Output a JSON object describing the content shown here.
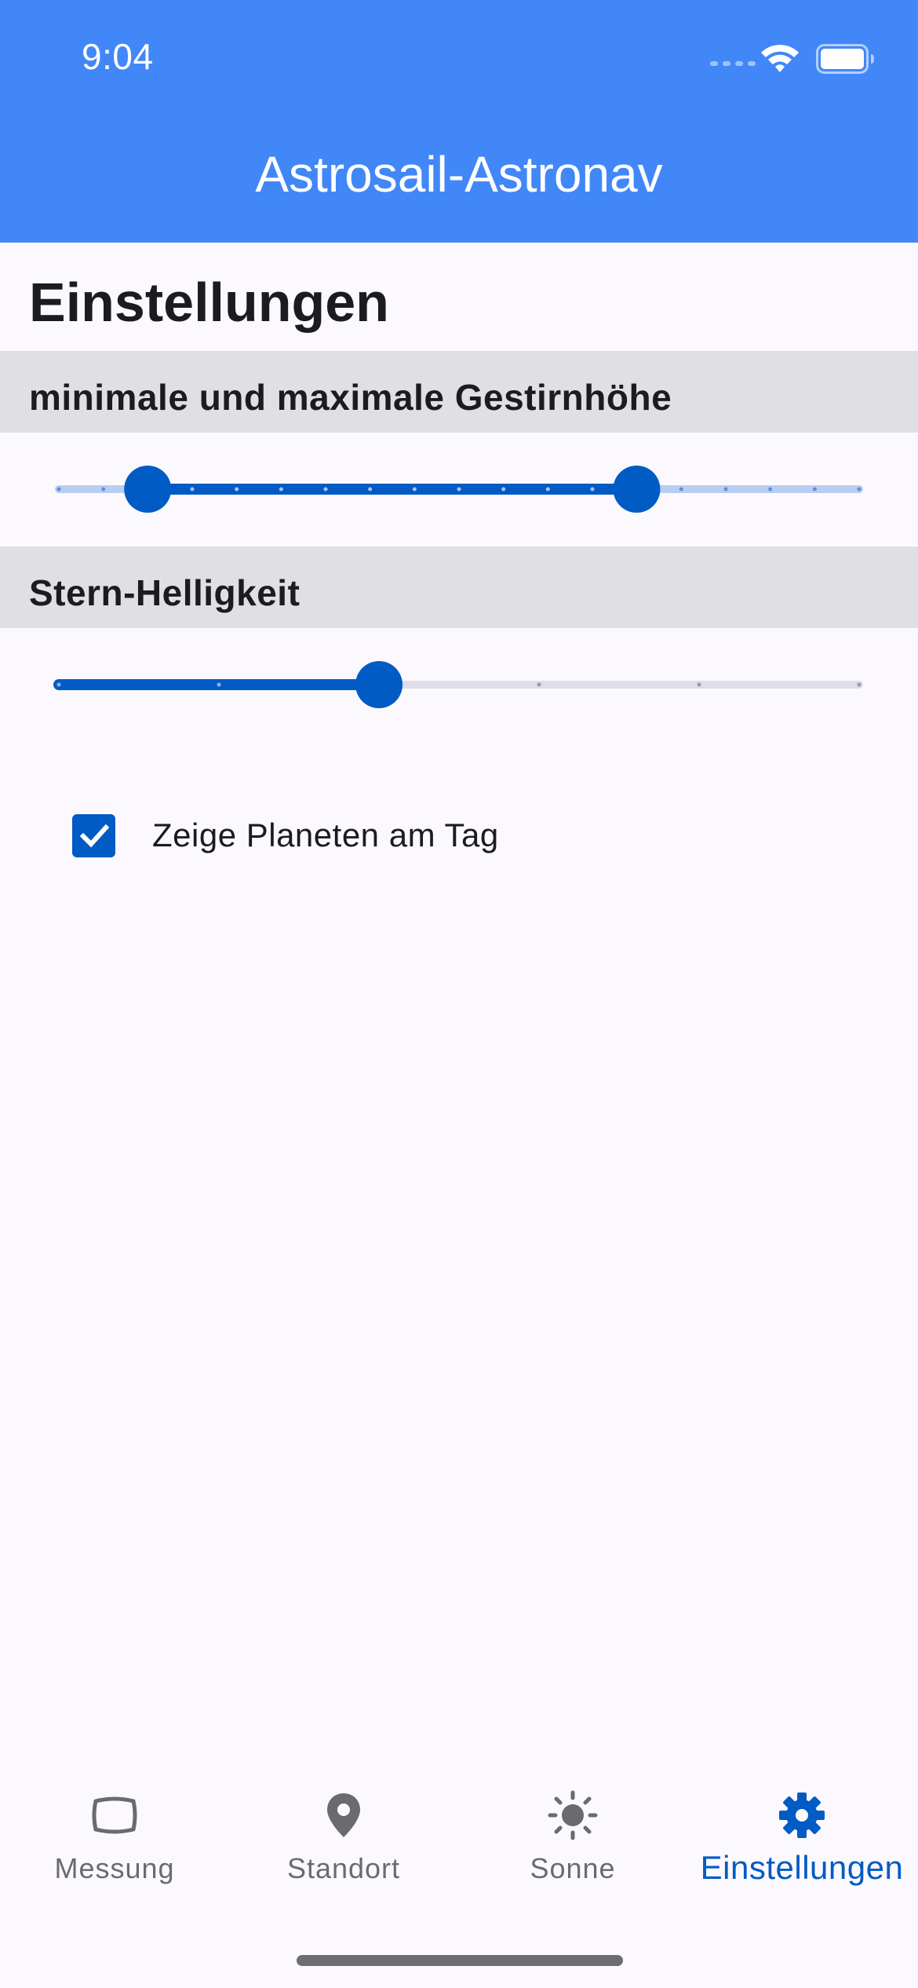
{
  "status_bar": {
    "time": "9:04"
  },
  "app_bar": {
    "title": "Astrosail-Astronav"
  },
  "page": {
    "title": "Einstellungen"
  },
  "sections": {
    "altitude": {
      "header": "minimale und maximale Gestirnhöhe",
      "slider": {
        "divisions": 18,
        "low_fraction": 0.111,
        "high_fraction": 0.722
      }
    },
    "brightness": {
      "header": "Stern-Helligkeit",
      "slider": {
        "divisions": 5,
        "value_fraction": 0.4
      }
    }
  },
  "checkbox": {
    "label": "Zeige Planeten am Tag",
    "checked": true
  },
  "bottom_nav": {
    "items": [
      {
        "label": "Messung",
        "icon": "tv-frame-icon",
        "active": false
      },
      {
        "label": "Standort",
        "icon": "location-pin-icon",
        "active": false
      },
      {
        "label": "Sonne",
        "icon": "sun-icon",
        "active": false
      },
      {
        "label": "Einstellungen",
        "icon": "gear-icon",
        "active": true
      }
    ]
  },
  "colors": {
    "app_bar": "#4187f8",
    "accent": "#005bc4",
    "section_header": "#e0dfe3",
    "background": "#fcf9fe",
    "inactive_nav": "#6b6b6f"
  }
}
